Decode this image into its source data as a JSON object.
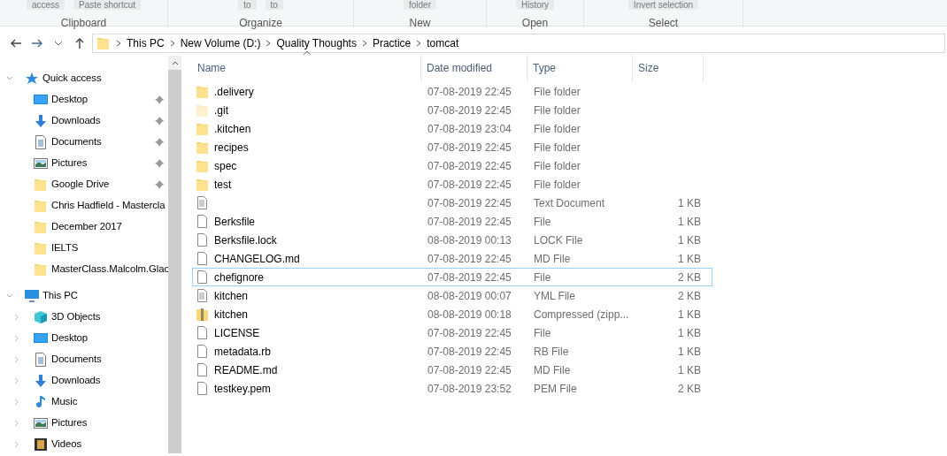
{
  "ribbon": {
    "groups": [
      {
        "label": "Clipboard",
        "items": [
          "access",
          "Paste shortcut"
        ]
      },
      {
        "label": "Organize",
        "items": [
          "to",
          "to"
        ]
      },
      {
        "label": "New",
        "items": [
          "folder"
        ]
      },
      {
        "label": "Open",
        "items": [
          "History"
        ]
      },
      {
        "label": "Select",
        "items": [
          "Invert selection"
        ]
      }
    ]
  },
  "address": {
    "path": [
      "This PC",
      "New Volume (D:)",
      "Quality Thoughts",
      "Practice",
      "tomcat"
    ]
  },
  "sidebar": {
    "items": [
      {
        "label": "Quick access",
        "kind": "star",
        "expanded": true,
        "children": [
          {
            "label": "Desktop",
            "kind": "desktop",
            "pinned": true
          },
          {
            "label": "Downloads",
            "kind": "download",
            "pinned": true
          },
          {
            "label": "Documents",
            "kind": "document",
            "pinned": true
          },
          {
            "label": "Pictures",
            "kind": "picture",
            "pinned": true
          },
          {
            "label": "Google Drive",
            "kind": "folder",
            "pinned": true
          },
          {
            "label": "Chris Hadfield - Mastercla",
            "kind": "folder",
            "pinned": false
          },
          {
            "label": "December 2017",
            "kind": "folder",
            "pinned": false
          },
          {
            "label": "IELTS",
            "kind": "folder",
            "pinned": false
          },
          {
            "label": "MasterClass.Malcolm.Glac",
            "kind": "folder",
            "pinned": false
          }
        ]
      },
      {
        "label": "This PC",
        "kind": "pc",
        "expanded": true,
        "children": [
          {
            "label": "3D Objects",
            "kind": "cube",
            "expanded": false
          },
          {
            "label": "Desktop",
            "kind": "desktop",
            "expanded": false
          },
          {
            "label": "Documents",
            "kind": "document",
            "expanded": false
          },
          {
            "label": "Downloads",
            "kind": "download",
            "expanded": false
          },
          {
            "label": "Music",
            "kind": "music",
            "expanded": false
          },
          {
            "label": "Pictures",
            "kind": "picture",
            "expanded": false
          },
          {
            "label": "Videos",
            "kind": "video",
            "expanded": false
          }
        ]
      }
    ]
  },
  "table": {
    "columns": [
      "Name",
      "Date modified",
      "Type",
      "Size"
    ],
    "rows": [
      {
        "name": ".delivery",
        "date": "07-08-2019 22:45",
        "type": "File folder",
        "kind": "folder",
        "focused": false
      },
      {
        "name": ".git",
        "date": "07-08-2019 22:45",
        "type": "File folder",
        "kind": "hidden-folder",
        "focused": false
      },
      {
        "name": ".kitchen",
        "date": "07-08-2019 23:04",
        "type": "File folder",
        "kind": "folder",
        "focused": false
      },
      {
        "name": "recipes",
        "date": "07-08-2019 22:45",
        "type": "File folder",
        "kind": "folder",
        "focused": false
      },
      {
        "name": "spec",
        "date": "07-08-2019 22:45",
        "type": "File folder",
        "kind": "folder",
        "focused": false
      },
      {
        "name": "test",
        "date": "07-08-2019 22:45",
        "type": "File folder",
        "kind": "folder",
        "focused": false
      },
      {
        "date": "07-08-2019 22:45",
        "type": "Text Document",
        "size": "1 KB",
        "kind": "text",
        "focused": false
      },
      {
        "name": "Berksfile",
        "date": "07-08-2019 22:45",
        "type": "File",
        "size": "1 KB",
        "kind": "file",
        "focused": false
      },
      {
        "name": "Berksfile.lock",
        "date": "08-08-2019 00:13",
        "type": "LOCK File",
        "size": "1 KB",
        "kind": "file",
        "focused": false
      },
      {
        "name": "CHANGELOG.md",
        "date": "07-08-2019 22:45",
        "type": "MD File",
        "size": "1 KB",
        "kind": "file",
        "focused": false
      },
      {
        "name": "chefignore",
        "date": "07-08-2019 22:45",
        "type": "File",
        "size": "2 KB",
        "kind": "file",
        "focused": true
      },
      {
        "name": "kitchen",
        "date": "08-08-2019 00:07",
        "type": "YML File",
        "size": "2 KB",
        "kind": "text",
        "focused": false
      },
      {
        "name": "kitchen",
        "date": "08-08-2019 00:18",
        "type": "Compressed (zipp...",
        "size": "1 KB",
        "kind": "zip",
        "focused": false
      },
      {
        "name": "LICENSE",
        "date": "07-08-2019 22:45",
        "type": "File",
        "size": "1 KB",
        "kind": "file",
        "focused": false
      },
      {
        "name": "metadata.rb",
        "date": "07-08-2019 22:45",
        "type": "RB File",
        "size": "1 KB",
        "kind": "file",
        "focused": false
      },
      {
        "name": "README.md",
        "date": "07-08-2019 22:45",
        "type": "MD File",
        "size": "1 KB",
        "kind": "file",
        "focused": false
      },
      {
        "name": "testkey.pem",
        "date": "07-08-2019 23:52",
        "type": "PEM File",
        "size": "2 KB",
        "kind": "file",
        "focused": false
      }
    ]
  }
}
